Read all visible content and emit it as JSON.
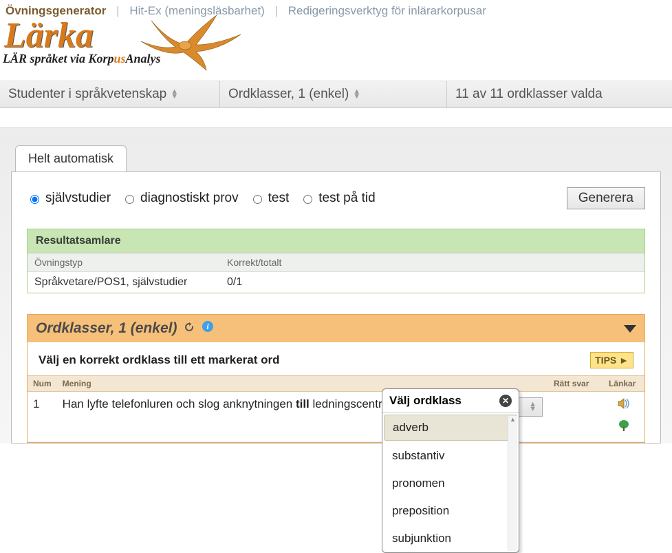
{
  "topnav": {
    "items": [
      {
        "label": "Övningsgenerator",
        "active": true
      },
      {
        "label": "Hit-Ex (meningsläsbarhet)",
        "active": false
      },
      {
        "label": "Redigeringsverktyg för inlärarkorpusar",
        "active": false
      }
    ]
  },
  "brand": {
    "name": "Lärka",
    "tagline_prefix": "LÄR språket via Korp",
    "tagline_mid": "us",
    "tagline_suffix": "Analys"
  },
  "selectors": {
    "audience": "Studenter i språkvetenskap",
    "exercise_set": "Ordklasser, 1 (enkel)",
    "selection_status": "11 av 11 ordklasser valda"
  },
  "tabs": {
    "active": "Helt automatisk"
  },
  "modes": {
    "options": [
      "självstudier",
      "diagnostiskt prov",
      "test",
      "test på tid"
    ],
    "selected": "självstudier",
    "generate_label": "Generera"
  },
  "results": {
    "title": "Resultatsamlare",
    "columns": [
      "Övningstyp",
      "Korrekt/totalt"
    ],
    "rows": [
      {
        "type": "Språkvetare/POS1, självstudier",
        "score": "0/1"
      }
    ]
  },
  "exercise": {
    "title": "Ordklasser, 1 (enkel)",
    "instruction": "Välj en korrekt ordklass till ett markerat ord",
    "tips_label": "TIPS ►",
    "columns": {
      "num": "Num",
      "sentence": "Mening",
      "answer": "Rätt svar",
      "links": "Länkar"
    },
    "rows": [
      {
        "num": "1",
        "sentence_pre": "Han lyfte telefonluren och slog anknytningen ",
        "sentence_bold": "till",
        "sentence_post": " ledningscentralen .",
        "select_label": "Välj ordklass"
      }
    ]
  },
  "popup": {
    "title": "Välj ordklass",
    "options": [
      "adverb",
      "substantiv",
      "pronomen",
      "preposition",
      "subjunktion"
    ],
    "selected": "adverb"
  },
  "icons": {
    "refresh": "refresh-icon",
    "info": "info-icon",
    "speaker": "speaker-icon",
    "tree": "tree-icon",
    "close": "close-icon"
  }
}
